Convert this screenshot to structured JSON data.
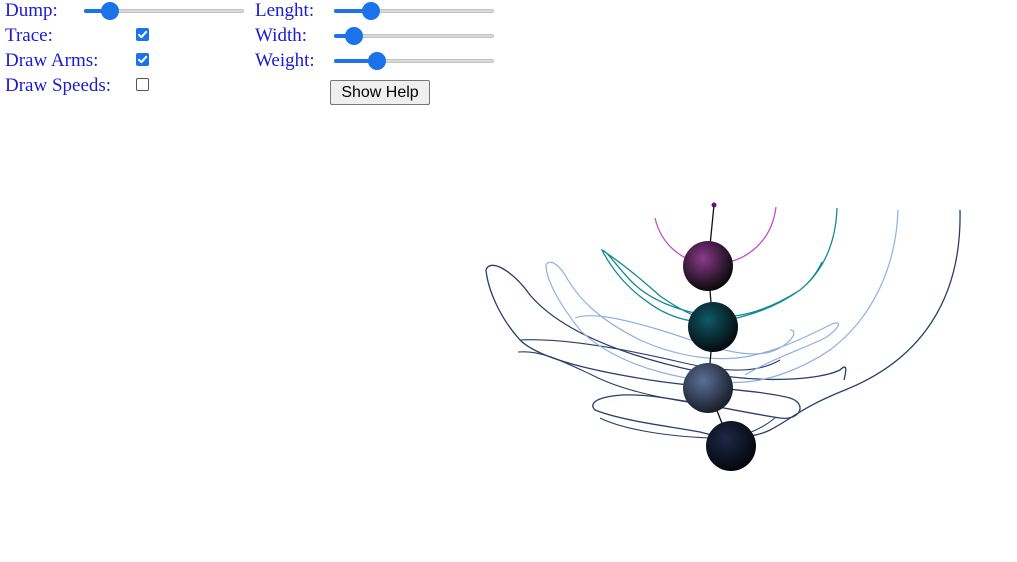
{
  "controls": {
    "dump": {
      "label": "Dump:",
      "value": 0.12
    },
    "lenght": {
      "label": "Lenght:",
      "value": 0.2
    },
    "trace": {
      "label": "Trace:",
      "checked": true
    },
    "width": {
      "label": "Width:",
      "value": 0.08
    },
    "draw_arms": {
      "label": "Draw Arms:",
      "checked": true
    },
    "weight": {
      "label": "Weight:",
      "value": 0.24
    },
    "draw_speeds": {
      "label": "Draw Speeds:",
      "checked": false
    },
    "help_button": {
      "label": "Show Help"
    }
  },
  "colors": {
    "label_text": "#1b1bd1",
    "slider_accent": "#1a73e8",
    "ball_1": "#8a3a8a",
    "ball_2": "#0e5a66",
    "ball_3": "#5a7098",
    "ball_4": "#1e2846",
    "trace_1": "#c34fc9",
    "trace_2": "#138a93",
    "trace_3": "#8fb0df",
    "trace_4": "#2b3d6b"
  }
}
